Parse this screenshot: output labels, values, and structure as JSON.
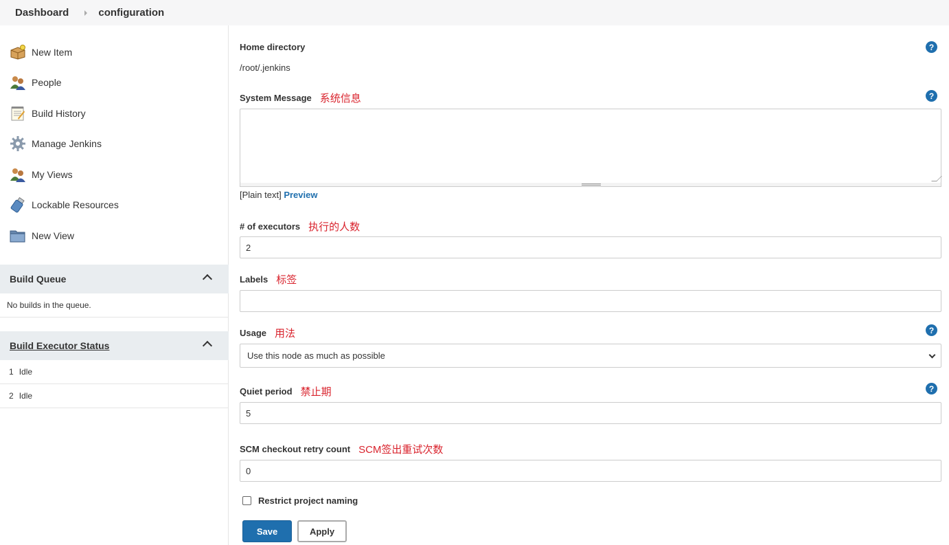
{
  "breadcrumb": {
    "items": [
      "Dashboard",
      "configuration"
    ]
  },
  "sidebar": {
    "tasks": [
      {
        "label": "New Item",
        "icon": "new-item-icon"
      },
      {
        "label": "People",
        "icon": "people-icon"
      },
      {
        "label": "Build History",
        "icon": "notepad-icon"
      },
      {
        "label": "Manage Jenkins",
        "icon": "gear-icon"
      },
      {
        "label": "My Views",
        "icon": "people-icon"
      },
      {
        "label": "Lockable Resources",
        "icon": "usb-drive-icon"
      },
      {
        "label": "New View",
        "icon": "folder-icon"
      }
    ],
    "build_queue": {
      "title": "Build Queue",
      "empty_text": "No builds in the queue."
    },
    "executor_status": {
      "title": "Build Executor Status",
      "executors": [
        {
          "num": "1",
          "state": "Idle"
        },
        {
          "num": "2",
          "state": "Idle"
        }
      ]
    }
  },
  "form": {
    "home_directory": {
      "label": "Home directory",
      "value": "/root/.jenkins"
    },
    "system_message": {
      "label": "System Message",
      "annotation": "系统信息",
      "value": "",
      "plain_text": "[Plain text]",
      "preview_label": "Preview"
    },
    "executors": {
      "label": "# of executors",
      "annotation": "执行的人数",
      "value": "2"
    },
    "labels": {
      "label": "Labels",
      "annotation": "标签",
      "value": ""
    },
    "usage": {
      "label": "Usage",
      "annotation": "用法",
      "selected": "Use this node as much as possible"
    },
    "quiet_period": {
      "label": "Quiet period",
      "annotation": "禁止期",
      "value": "5"
    },
    "scm_retry": {
      "label": "SCM checkout retry count",
      "annotation": "SCM签出重试次数",
      "value": "0"
    },
    "restrict_naming": {
      "label": "Restrict project naming",
      "checked": false
    },
    "help_glyph": "?",
    "save_label": "Save",
    "apply_label": "Apply"
  },
  "colors": {
    "accent": "#1f6fae",
    "annotation": "#d9232d",
    "panel_bg": "#e9edf0",
    "topbar_bg": "#f6f6f7"
  }
}
